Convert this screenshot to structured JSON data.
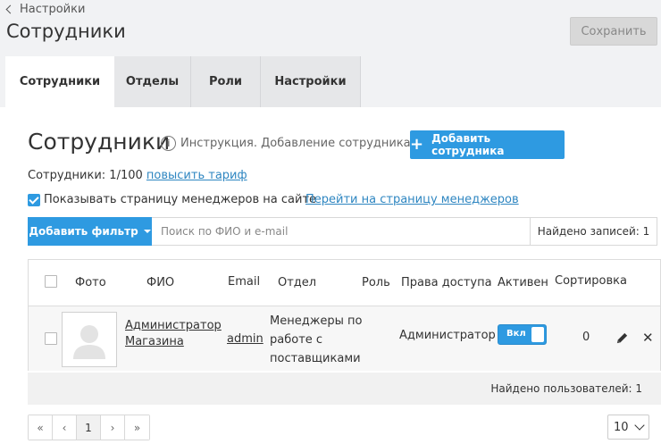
{
  "header": {
    "back_label": "Настройки",
    "title": "Сотрудники",
    "save_label": "Сохранить"
  },
  "tabs": [
    {
      "label": "Сотрудники",
      "active": true
    },
    {
      "label": "Отделы",
      "active": false
    },
    {
      "label": "Роли",
      "active": false
    },
    {
      "label": "Настройки",
      "active": false
    }
  ],
  "main": {
    "title": "Сотрудники",
    "instruction": "Инструкция. Добавление сотрудника",
    "add_label": "Добавить сотрудника",
    "quota_text": "Сотрудники: 1/100",
    "upgrade_link": "повысить тариф",
    "show_managers_label": "Показывать страницу менеджеров на сайте",
    "show_managers_checked": true,
    "goto_managers_link": "Перейти на страницу менеджеров"
  },
  "filter": {
    "add_filter_label": "Добавить фильтр",
    "search_placeholder": "Поиск по ФИО и e-mail",
    "search_value": "",
    "found_records": "Найдено записей: 1"
  },
  "table": {
    "columns": [
      "Фото",
      "ФИО",
      "Email",
      "Отдел",
      "Роль",
      "Права доступа",
      "Активен",
      "Сортировка"
    ],
    "rows": [
      {
        "name_line1": "Администратор",
        "name_line2": "Магазина",
        "email": "admin",
        "department_line1": "Менеджеры по",
        "department_line2": "работе с",
        "department_line3": "поставщиками",
        "role": "",
        "access": "Администратор",
        "active_label": "Вкл",
        "active": true,
        "sort": "0"
      }
    ],
    "footer": "Найдено пользователей: 1"
  },
  "pagination": {
    "first": "«",
    "prev": "‹",
    "current": "1",
    "next": "›",
    "last": "»",
    "per_page": "10"
  },
  "colors": {
    "accent": "#2e9ae1",
    "link": "#2e86c1",
    "topbar_bg": "#f1f2f4"
  }
}
